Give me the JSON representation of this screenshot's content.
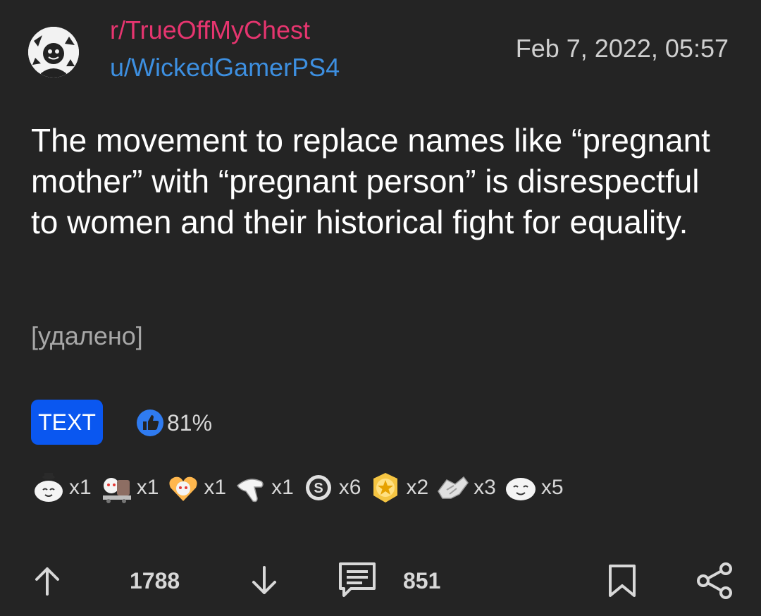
{
  "post": {
    "subreddit": "r/TrueOffMyChest",
    "author": "u/WickedGamerPS4",
    "date": "Feb 7, 2022, 05:57",
    "title": "The movement to replace names like “pregnant mother” with “pregnant person” is disrespectful to women and their historical fight for equality.",
    "body": "[удалено]",
    "flair": "TEXT",
    "upvote_ratio": "81%"
  },
  "awards": [
    {
      "icon": "wholesome-seal-award-icon",
      "count": "x1"
    },
    {
      "icon": "train-award-icon",
      "count": "x1"
    },
    {
      "icon": "heart-snoo-award-icon",
      "count": "x1"
    },
    {
      "icon": "pointing-hand-award-icon",
      "count": "x1"
    },
    {
      "icon": "silver-award-icon",
      "count": "x6"
    },
    {
      "icon": "gold-award-icon",
      "count": "x2"
    },
    {
      "icon": "handshake-award-icon",
      "count": "x3"
    },
    {
      "icon": "seal-award-icon",
      "count": "x5"
    }
  ],
  "actions": {
    "score": "1788",
    "comments": "851"
  },
  "colors": {
    "background": "#242424",
    "subreddit": "#e6356f",
    "username": "#3d8fe0",
    "flair": "#0a57f0",
    "upvote_ratio_icon": "#2f7bf0"
  }
}
